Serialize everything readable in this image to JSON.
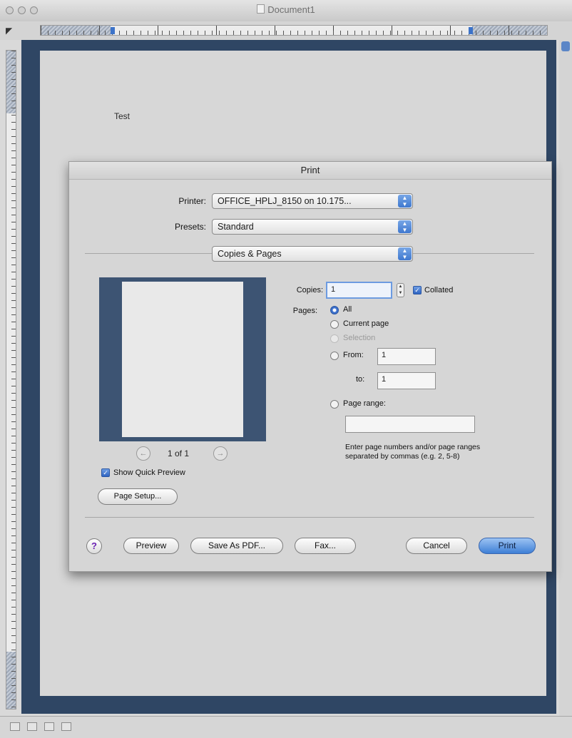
{
  "window": {
    "title": "Document1",
    "ruler_corner": "◤"
  },
  "document": {
    "body_text": "Test"
  },
  "print_dialog": {
    "title": "Print",
    "printer": {
      "label": "Printer:",
      "value": "OFFICE_HPLJ_8150 on 10.175..."
    },
    "presets": {
      "label": "Presets:",
      "value": "Standard"
    },
    "panel": {
      "value": "Copies & Pages"
    },
    "preview": {
      "page_indicator": "1 of 1",
      "prev_icon": "←",
      "next_icon": "→"
    },
    "show_quick_preview": {
      "label": "Show Quick Preview",
      "checked": true
    },
    "page_setup_label": "Page Setup...",
    "copies": {
      "label": "Copies:",
      "value": "1",
      "collated_label": "Collated",
      "collated": true
    },
    "pages": {
      "label": "Pages:",
      "all": "All",
      "current_page": "Current page",
      "selection": "Selection",
      "from_label": "From:",
      "from_value": "1",
      "to_label": "to:",
      "to_value": "1",
      "page_range_label": "Page range:",
      "page_range_value": "",
      "selected": "All"
    },
    "hint": "Enter page numbers and/or page ranges separated by commas (e.g. 2, 5-8)",
    "buttons": {
      "help": "?",
      "preview": "Preview",
      "save_pdf": "Save As PDF...",
      "fax": "Fax...",
      "cancel": "Cancel",
      "print": "Print"
    }
  },
  "colors": {
    "accent": "#3e7fd6",
    "workspace": "#2f4664"
  }
}
